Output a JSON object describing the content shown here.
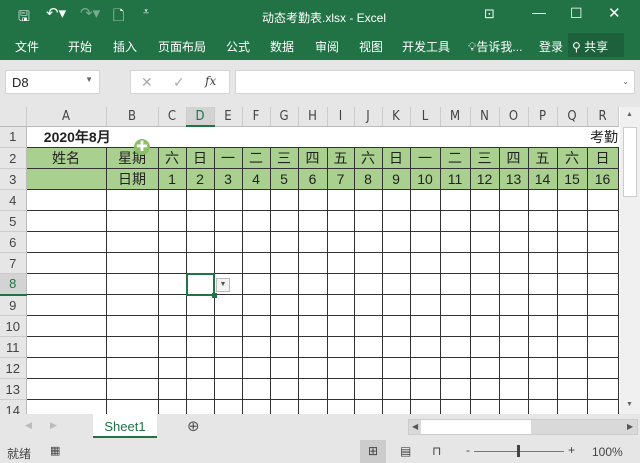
{
  "window": {
    "title": "动态考勤表.xlsx - Excel"
  },
  "ribbon": {
    "tabs": [
      "文件",
      "开始",
      "插入",
      "页面布局",
      "公式",
      "数据",
      "审阅",
      "视图",
      "开发工具"
    ],
    "tell_me": "告诉我...",
    "login": "登录",
    "share": "共享"
  },
  "formula_bar": {
    "name_box": "D8",
    "fx": "fx",
    "value": ""
  },
  "columns": [
    "A",
    "B",
    "C",
    "D",
    "E",
    "F",
    "G",
    "H",
    "I",
    "J",
    "K",
    "L",
    "M",
    "N",
    "O",
    "P",
    "Q",
    "R"
  ],
  "rows": [
    1,
    2,
    3,
    4,
    5,
    6,
    7,
    8,
    9,
    10,
    11,
    12,
    13,
    14
  ],
  "cells": {
    "title": "2020年8月",
    "right_title": "考勤",
    "name_header": "姓名",
    "weekday_header": "星期",
    "date_header": "日期",
    "weekdays": [
      "六",
      "日",
      "一",
      "二",
      "三",
      "四",
      "五",
      "六",
      "日",
      "一",
      "二",
      "三",
      "四",
      "五",
      "六",
      "日"
    ],
    "dates": [
      "1",
      "2",
      "3",
      "4",
      "5",
      "6",
      "7",
      "8",
      "9",
      "10",
      "11",
      "12",
      "13",
      "14",
      "15",
      "16"
    ]
  },
  "sheet_tabs": [
    "Sheet1"
  ],
  "status": {
    "ready": "就绪",
    "zoom": "100%"
  },
  "colors": {
    "accent": "#217346",
    "header_fill": "#a9d08e"
  }
}
